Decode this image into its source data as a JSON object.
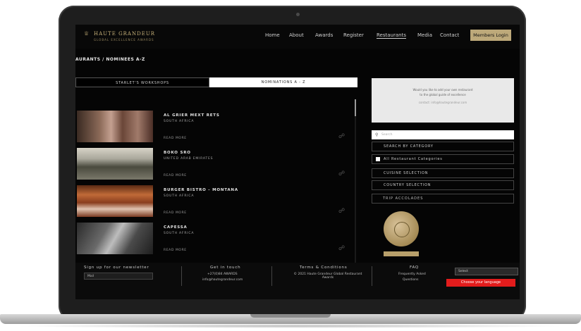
{
  "nav": {
    "logo_title": "HAUTE GRANDEUR",
    "logo_subtitle": "GLOBAL EXCELLENCE AWARDS",
    "items": [
      "Home",
      "About",
      "Awards",
      "Register",
      "Restaurants",
      "Media",
      "Contact"
    ],
    "member_login": "Members Login"
  },
  "breadcrumb": "AURANTS / NOMINEES A-Z",
  "tabs": [
    "STARLET'S WORKSHOPS",
    "NOMINATIONS A - Z"
  ],
  "restaurants": [
    {
      "name": "AL GRIER MEXT RETS",
      "country": "SOUTH AFRICA",
      "read_more": "READ MORE"
    },
    {
      "name": "BOKO SRO",
      "country": "UNITED ARAB EMIRATES",
      "read_more": "READ MORE"
    },
    {
      "name": "BURGER BISTRO - MONTANA",
      "country": "SOUTH AFRICA",
      "read_more": "READ MORE"
    },
    {
      "name": "CAPESSA",
      "country": "SOUTH AFRICA",
      "read_more": "READ MORE"
    }
  ],
  "sidebar": {
    "ad_lines": [
      "Would you like to add your own restaurant",
      "to the global guide of excellence",
      "contact: info@hautegrandeur.com"
    ],
    "search_placeholder": "Search",
    "search_by_category": "SEARCH BY CATEGORY",
    "all_categories": "All Restaurant Categories",
    "cuisine_selection": "CUISINE SELECTION",
    "country_selection": "COUNTRY SELECTION",
    "trip_title": "TRIP ACCOLADES"
  },
  "footer": {
    "newsletter_heading": "Sign up for our newsletter",
    "newsletter_value": "Mail",
    "contact_heading": "Get in touch",
    "contact_phone": "+27(0)84 AWARDS",
    "contact_email": "info@hautegrandeur.com",
    "terms_heading": "Terms & Conditions",
    "terms_text": "© 2021 Haute Grandeur Global Restaurant Awards",
    "faq_heading": "FAQ",
    "faq_text_1": "Frequently Asked",
    "faq_text_2": "Questions",
    "language_value": "Select",
    "language_button": "Choose your language"
  },
  "colors": {
    "accent_gold": "#bda97a",
    "footer_button_red": "#e21c1c"
  },
  "icons": {
    "share": "share-icon",
    "search": "search-icon",
    "medal": "award-medal-icon"
  }
}
